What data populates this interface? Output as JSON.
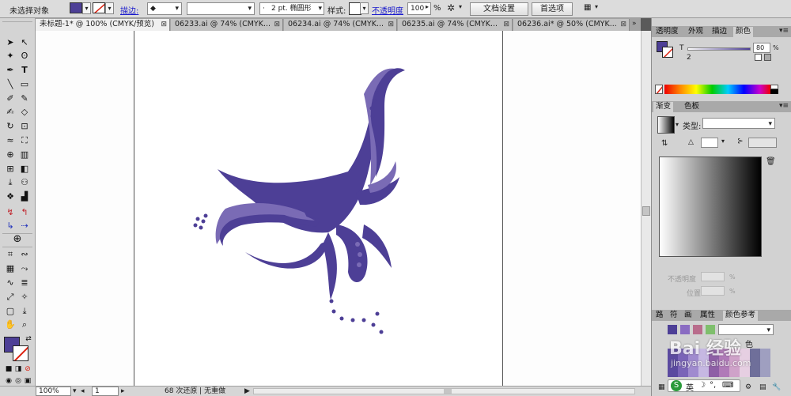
{
  "control_bar": {
    "selection_label": "未选择对象",
    "stroke_label": "描边:",
    "stroke_weight": "2 pt. 椭圆形",
    "style_label": "样式:",
    "opacity_label": "不透明度",
    "opacity_value": "100",
    "opacity_unit": "%",
    "doc_setup_button": "文档设置",
    "preferences_button": "首选项",
    "fill_color": "#4d3f96"
  },
  "tabs": [
    {
      "label": "未标题-1* @ 100% (CMYK/预览)",
      "close": "⊠"
    },
    {
      "label": "06233.ai @ 74% (CMYK...",
      "close": "⊠"
    },
    {
      "label": "06234.ai @ 74% (CMYK...",
      "close": "⊠"
    },
    {
      "label": "06235.ai @ 74% (CMYK...",
      "close": "⊠"
    },
    {
      "label": "06236.ai* @ 50% (CMYK...",
      "close": "⊠"
    }
  ],
  "status": {
    "zoom": "100%",
    "page": "1",
    "history": "68 次还原 | 无重做"
  },
  "panels": {
    "top_tabs": [
      "透明度",
      "外观",
      "描边",
      "颜色"
    ],
    "color": {
      "t_label": "T",
      "t_value": "80",
      "t_unit": "%",
      "number": "2"
    },
    "gradient_tabs": [
      "渐变",
      "色板"
    ],
    "gradient": {
      "type_label": "类型:"
    },
    "dim_labels": {
      "opacity": "不透明度",
      "location": "位置",
      "unit": "%"
    },
    "bottom_tabs": [
      "路",
      "符",
      "画",
      "属性",
      "颜色参考"
    ],
    "color_ref_text": "色"
  },
  "watermark": {
    "brand": "Bai 经验",
    "url": "jingyan.baidu.com"
  },
  "ime": {
    "label": "英"
  }
}
